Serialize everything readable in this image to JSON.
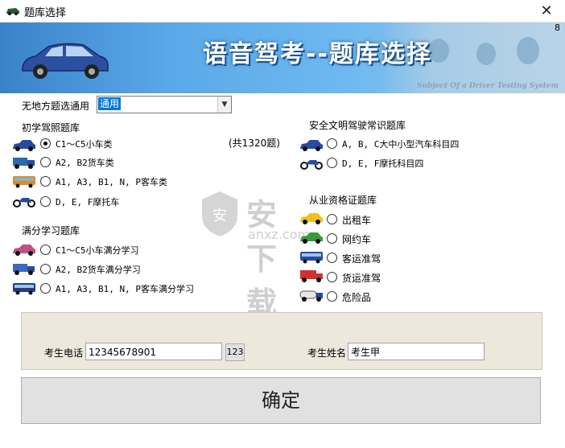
{
  "window": {
    "title": "题库选择",
    "close_icon": "close-icon"
  },
  "banner": {
    "headline": "语音驾考--题库选择",
    "subtitle": "Subject Of a Driver Testing System",
    "corner_number": "8"
  },
  "region": {
    "label": "无地方题选通用",
    "selected": "通用"
  },
  "beginner": {
    "heading": "初学驾照题库",
    "total": "(共1320题)",
    "options": [
      "C1～C5小车类",
      "A2, B2货车类",
      "A1, A3, B1, N, P客车类",
      "D, E, F摩托车"
    ],
    "selected_index": 0
  },
  "fullscore": {
    "heading": "满分学习题库",
    "options": [
      "C1～C5小车满分学习",
      "A2, B2货车满分学习",
      "A1, A3, B1, N, P客车满分学习"
    ]
  },
  "safety": {
    "heading": "安全文明驾驶常识题库",
    "options": [
      "A, B, C大中小型汽车科目四",
      "D, E, F摩托科目四"
    ]
  },
  "qualification": {
    "heading": "从业资格证题库",
    "options": [
      "出租车",
      "网约车",
      "客运准驾",
      "货运准驾",
      "危险品"
    ]
  },
  "form": {
    "phone_label": "考生电话",
    "phone_value": "12345678901",
    "keypad_label": "123",
    "name_label": "考生姓名",
    "name_value": "考生甲"
  },
  "confirm_label": "确定",
  "watermark": {
    "text": "安下载",
    "sub": "anxz.com"
  },
  "colors": {
    "banner": "#4a98dc",
    "panel": "#ede8dc",
    "selection": "#0078d7"
  }
}
